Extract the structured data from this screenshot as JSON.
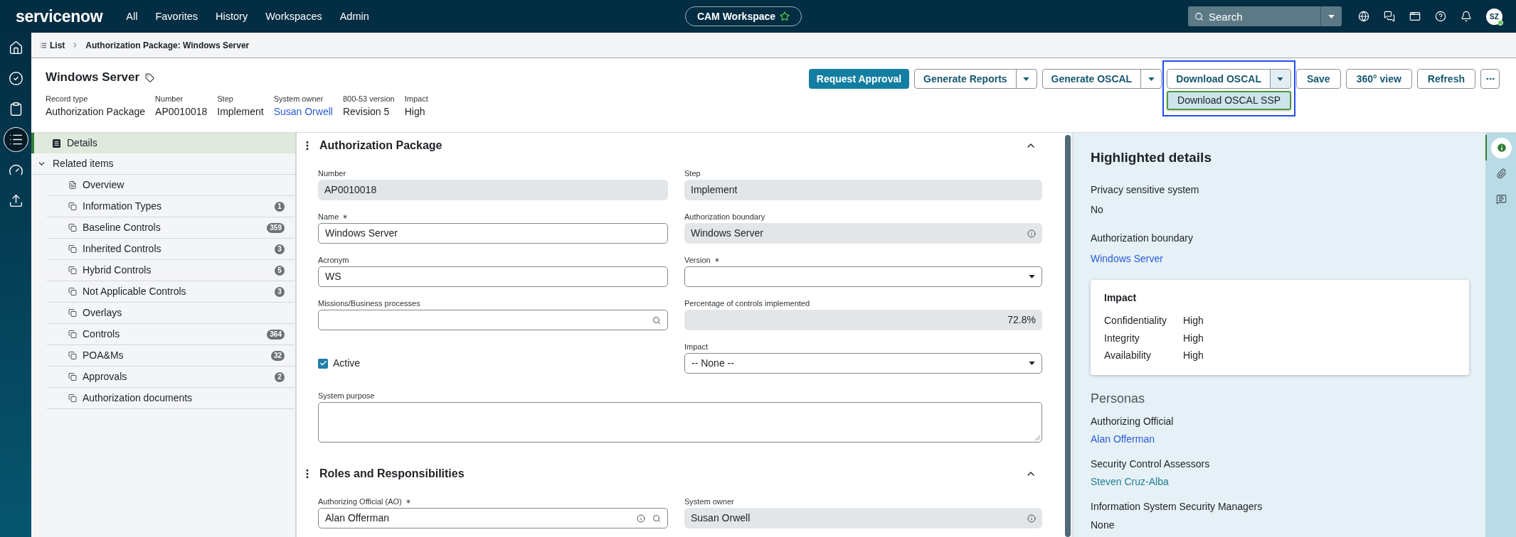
{
  "top_bar": {
    "logo": "servicenow",
    "nav": [
      {
        "label": "All"
      },
      {
        "label": "Favorites"
      },
      {
        "label": "History"
      },
      {
        "label": "Workspaces"
      },
      {
        "label": "Admin"
      }
    ],
    "workspace": {
      "label": "CAM Workspace",
      "favorite": false
    },
    "search": {
      "placeholder": "Search"
    },
    "tools": [
      {
        "kind": "globe"
      },
      {
        "kind": "chat"
      },
      {
        "kind": "window"
      },
      {
        "kind": "help"
      },
      {
        "kind": "bell"
      }
    ],
    "avatar": {
      "initials": "SZ",
      "online": true
    }
  },
  "rail": [
    {
      "kind": "home",
      "selected": false
    },
    {
      "kind": "check",
      "selected": false
    },
    {
      "kind": "clipboard",
      "selected": false
    },
    {
      "kind": "list",
      "selected": true
    },
    {
      "kind": "analytics",
      "selected": false
    },
    {
      "kind": "upload",
      "selected": false
    }
  ],
  "breadcrumb": [
    {
      "label": "List",
      "kind": "link"
    },
    {
      "label": "Authorization Package: Windows Server",
      "kind": "current"
    }
  ],
  "record": {
    "title": "Windows Server",
    "meta": [
      {
        "label": "Record type",
        "value": "Authorization Package",
        "kind": "text"
      },
      {
        "label": "Number",
        "value": "AP0010018",
        "kind": "text"
      },
      {
        "label": "Step",
        "value": "Implement",
        "kind": "text"
      },
      {
        "label": "System owner",
        "value": "Susan Orwell",
        "kind": "link"
      },
      {
        "label": "800-53 version",
        "value": "Revision 5",
        "kind": "text"
      },
      {
        "label": "Impact",
        "value": "High",
        "kind": "text"
      }
    ]
  },
  "actions": [
    {
      "label": "Request Approval",
      "kind": "primary"
    },
    {
      "label": "Generate Reports",
      "kind": "split",
      "expanded": false
    },
    {
      "label": "Generate OSCAL",
      "kind": "split",
      "expanded": false
    },
    {
      "label": "Download OSCAL",
      "kind": "split",
      "expanded": true,
      "outlined": true,
      "menu": [
        {
          "label": "Download OSCAL SSP",
          "highlighted": true
        }
      ]
    },
    {
      "label": "Save",
      "kind": "plain"
    },
    {
      "label": "360° view",
      "kind": "plain"
    },
    {
      "label": "Refresh",
      "kind": "plain"
    },
    {
      "kind": "more"
    }
  ],
  "nav_panel": {
    "details": {
      "label": "Details",
      "selected": true
    },
    "related": {
      "label": "Related items",
      "expanded": true,
      "children": [
        {
          "label": "Overview",
          "kind": "page",
          "selected": false
        },
        {
          "label": "Information Types",
          "kind": "list",
          "count": "1",
          "selected": false
        },
        {
          "label": "Baseline Controls",
          "kind": "list",
          "count": "359",
          "selected": false
        },
        {
          "label": "Inherited Controls",
          "kind": "list",
          "count": "3",
          "selected": false
        },
        {
          "label": "Hybrid Controls",
          "kind": "list",
          "count": "5",
          "selected": false
        },
        {
          "label": "Not Applicable Controls",
          "kind": "list",
          "count": "3",
          "selected": false
        },
        {
          "label": "Overlays",
          "kind": "list",
          "selected": false
        },
        {
          "label": "Controls",
          "kind": "list",
          "count": "364",
          "selected": false
        },
        {
          "label": "POA&Ms",
          "kind": "list",
          "count": "32",
          "selected": false
        },
        {
          "label": "Approvals",
          "kind": "list",
          "count": "2",
          "selected": false
        },
        {
          "label": "Authorization documents",
          "kind": "list",
          "selected": false
        }
      ]
    }
  },
  "sections": [
    {
      "title": "Authorization Package",
      "expanded": true,
      "fields": [
        {
          "label": "Number",
          "value": "AP0010018",
          "kind": "text",
          "readonly": true,
          "required": false
        },
        {
          "label": "Step",
          "value": "Implement",
          "kind": "text",
          "readonly": true,
          "required": false
        },
        {
          "label": "Name",
          "value": "Windows Server",
          "kind": "text",
          "readonly": false,
          "required": true
        },
        {
          "label": "Authorization boundary",
          "value": "Windows Server",
          "kind": "reference",
          "readonly": true,
          "required": false,
          "info": true
        },
        {
          "label": "Acronym",
          "value": "WS",
          "kind": "text",
          "readonly": false,
          "required": false
        },
        {
          "label": "Version",
          "kind": "choice",
          "readonly": false,
          "required": true
        },
        {
          "label": "Missions/Business processes",
          "kind": "reference",
          "readonly": false,
          "required": false,
          "info": false
        },
        {
          "label": "Percentage of controls implemented",
          "value": "72.8%",
          "kind": "number",
          "readonly": true,
          "required": false
        },
        {
          "label": "Active",
          "kind": "checkbox",
          "checked": true
        },
        {
          "label": "Impact",
          "value": "-- None --",
          "kind": "choice",
          "readonly": false,
          "required": false
        },
        {
          "label": "System purpose",
          "kind": "textarea",
          "readonly": false,
          "required": false
        }
      ]
    },
    {
      "title": "Roles and Responsibilities",
      "expanded": true,
      "fields": [
        {
          "label": "Authorizing Official (AO)",
          "value": "Alan Offerman",
          "kind": "reference",
          "readonly": false,
          "required": true,
          "info": true
        },
        {
          "label": "System owner",
          "value": "Susan Orwell",
          "kind": "reference",
          "readonly": true,
          "required": false,
          "info": true
        }
      ]
    }
  ],
  "highlights": {
    "title": "Highlighted details",
    "fields": [
      {
        "label": "Privacy sensitive system",
        "value": "No",
        "kind": "text"
      },
      {
        "label": "Authorization boundary",
        "value": "Windows Server",
        "kind": "link"
      }
    ],
    "impact": {
      "title": "Impact",
      "rows": [
        {
          "label": "Confidentiality",
          "value": "High"
        },
        {
          "label": "Integrity",
          "value": "High"
        },
        {
          "label": "Availability",
          "value": "High"
        }
      ]
    },
    "personas": {
      "title": "Personas",
      "items": [
        {
          "label": "Authorizing Official",
          "value": "Alan Offerman",
          "kind": "link",
          "visited": false
        },
        {
          "label": "Security Control Assessors",
          "value": "Steven Cruz-Alba",
          "kind": "link",
          "visited": true
        },
        {
          "label": "Information System Security Managers",
          "value": "None",
          "kind": "text"
        }
      ]
    }
  },
  "side_tabs": [
    {
      "kind": "info",
      "selected": true
    },
    {
      "kind": "attachment",
      "selected": false
    },
    {
      "kind": "comments",
      "selected": false
    }
  ]
}
